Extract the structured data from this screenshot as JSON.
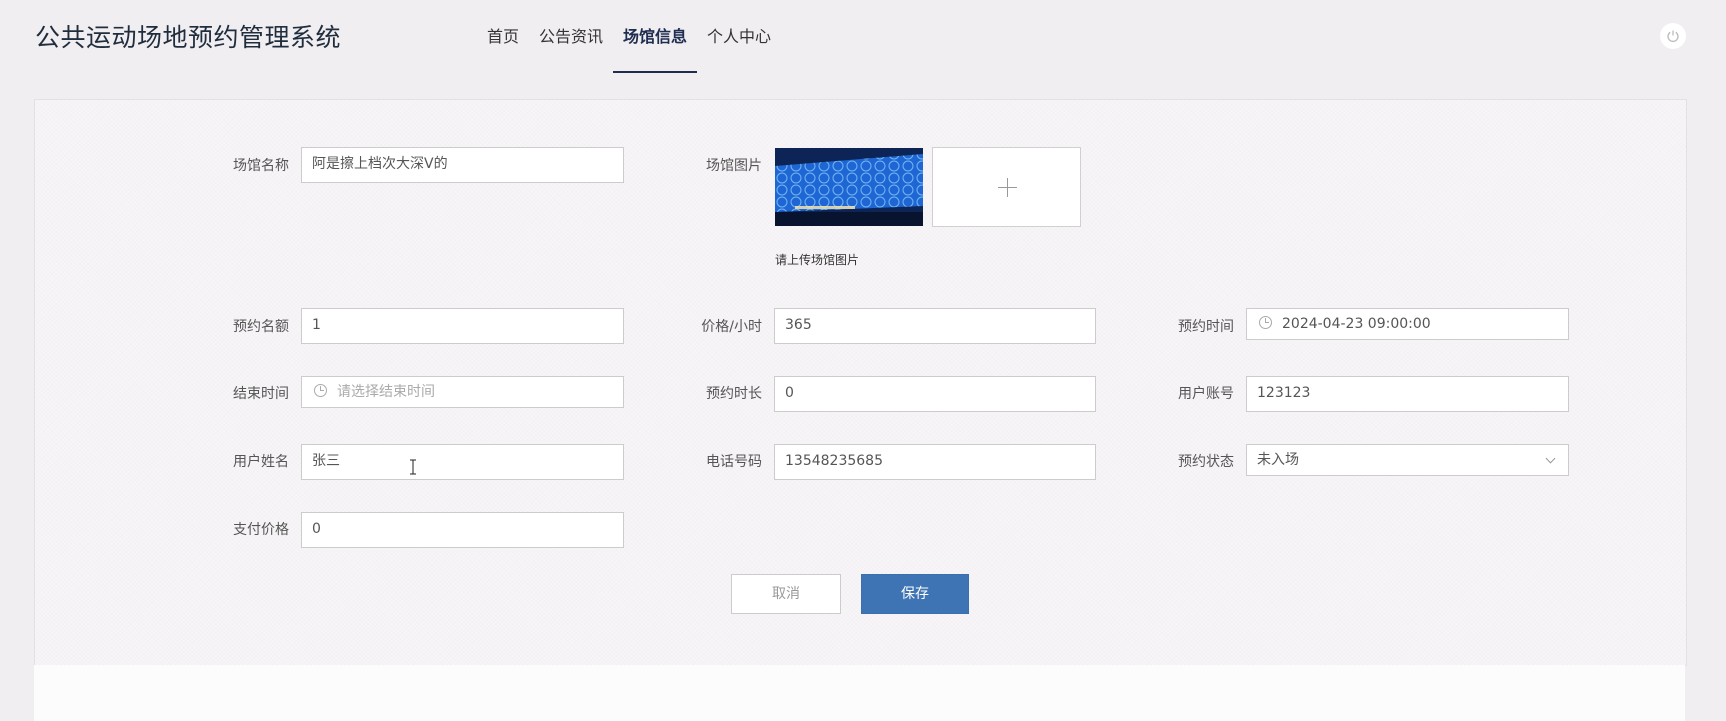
{
  "app": {
    "title": "公共运动场地预约管理系统"
  },
  "nav": {
    "items": [
      {
        "label": "首页",
        "active": false
      },
      {
        "label": "公告资讯",
        "active": false
      },
      {
        "label": "场馆信息",
        "active": true
      },
      {
        "label": "个人中心",
        "active": false
      }
    ]
  },
  "header": {
    "power_icon": "power-icon"
  },
  "form": {
    "venue_name": {
      "label": "场馆名称",
      "value": "阿是擦上档次大深V的"
    },
    "venue_image": {
      "label": "场馆图片",
      "hint": "请上传场馆图片",
      "upload_icon": "plus-icon"
    },
    "quota": {
      "label": "预约名额",
      "value": "1"
    },
    "price_per_hour": {
      "label": "价格/小时",
      "value": "365"
    },
    "booking_time": {
      "label": "预约时间",
      "value": "2024-04-23 09:00:00"
    },
    "end_time": {
      "label": "结束时间",
      "placeholder": "请选择结束时间"
    },
    "duration": {
      "label": "预约时长",
      "value": "0"
    },
    "user_account": {
      "label": "用户账号",
      "value": "123123"
    },
    "user_name": {
      "label": "用户姓名",
      "value": "张三"
    },
    "phone": {
      "label": "电话号码",
      "value": "13548235685"
    },
    "booking_status": {
      "label": "预约状态",
      "value": "未入场"
    },
    "paid_price": {
      "label": "支付价格",
      "value": "0"
    }
  },
  "buttons": {
    "cancel": "取消",
    "save": "保存"
  },
  "colors": {
    "primary": "#3e74b3",
    "nav_active": "#1f2d50",
    "background": "#f1eef1"
  }
}
